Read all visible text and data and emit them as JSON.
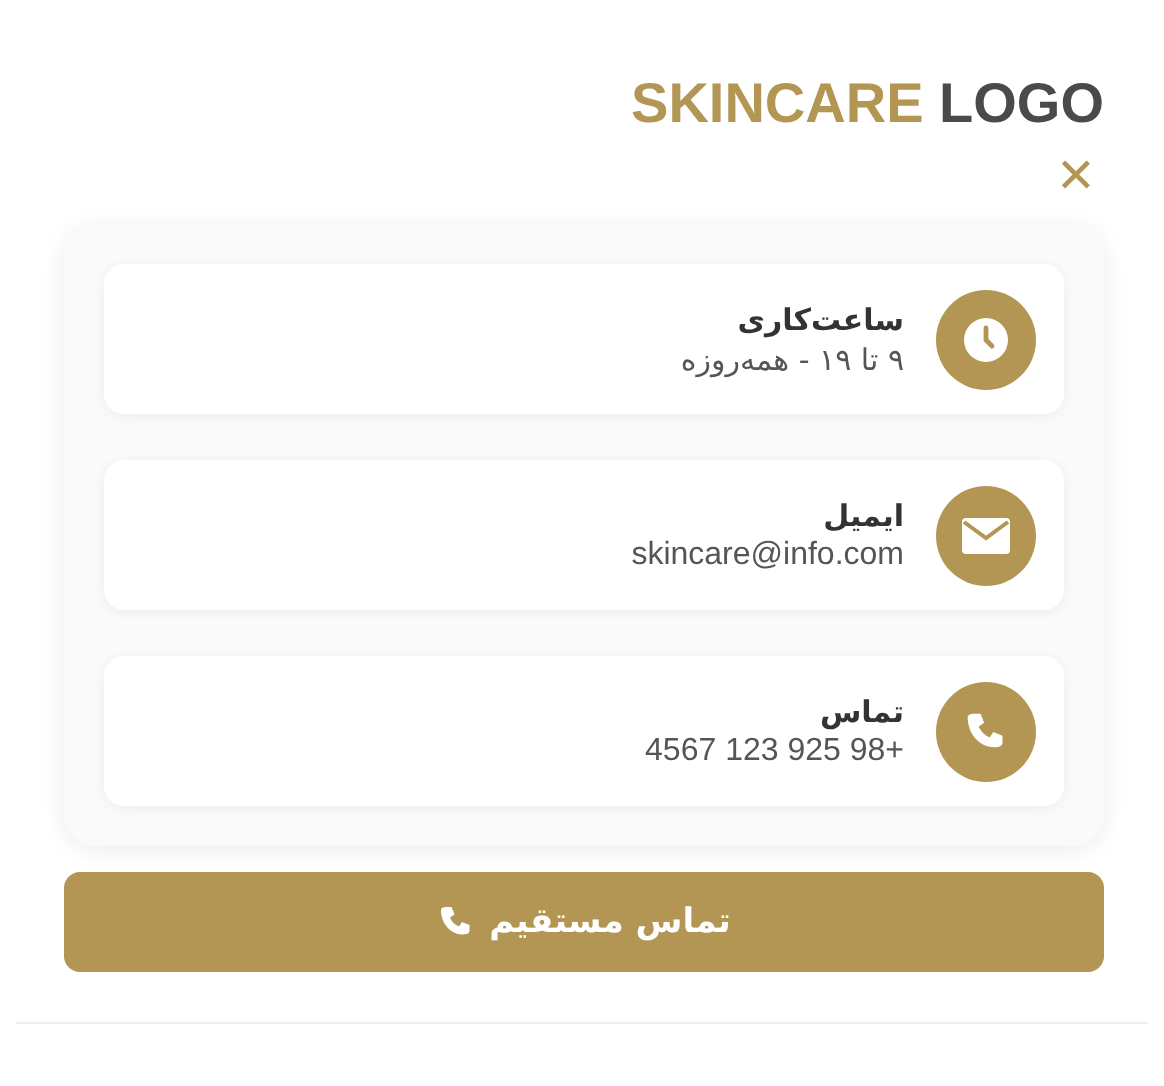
{
  "logo": {
    "primary": "SKINCARE",
    "secondary": "LOGO"
  },
  "close_button": {
    "label": "✕"
  },
  "contact_items": [
    {
      "kind": "clock",
      "title": "ساعت‌کاری",
      "value": "۹ تا ۱۹ - همه‌روزه"
    },
    {
      "kind": "mail",
      "title": "ایمیل",
      "value": "skincare@info.com"
    },
    {
      "kind": "phone",
      "title": "تماس",
      "value": "4567 123 925 98+"
    }
  ],
  "call_button": {
    "label": "تماس مستقیم"
  }
}
